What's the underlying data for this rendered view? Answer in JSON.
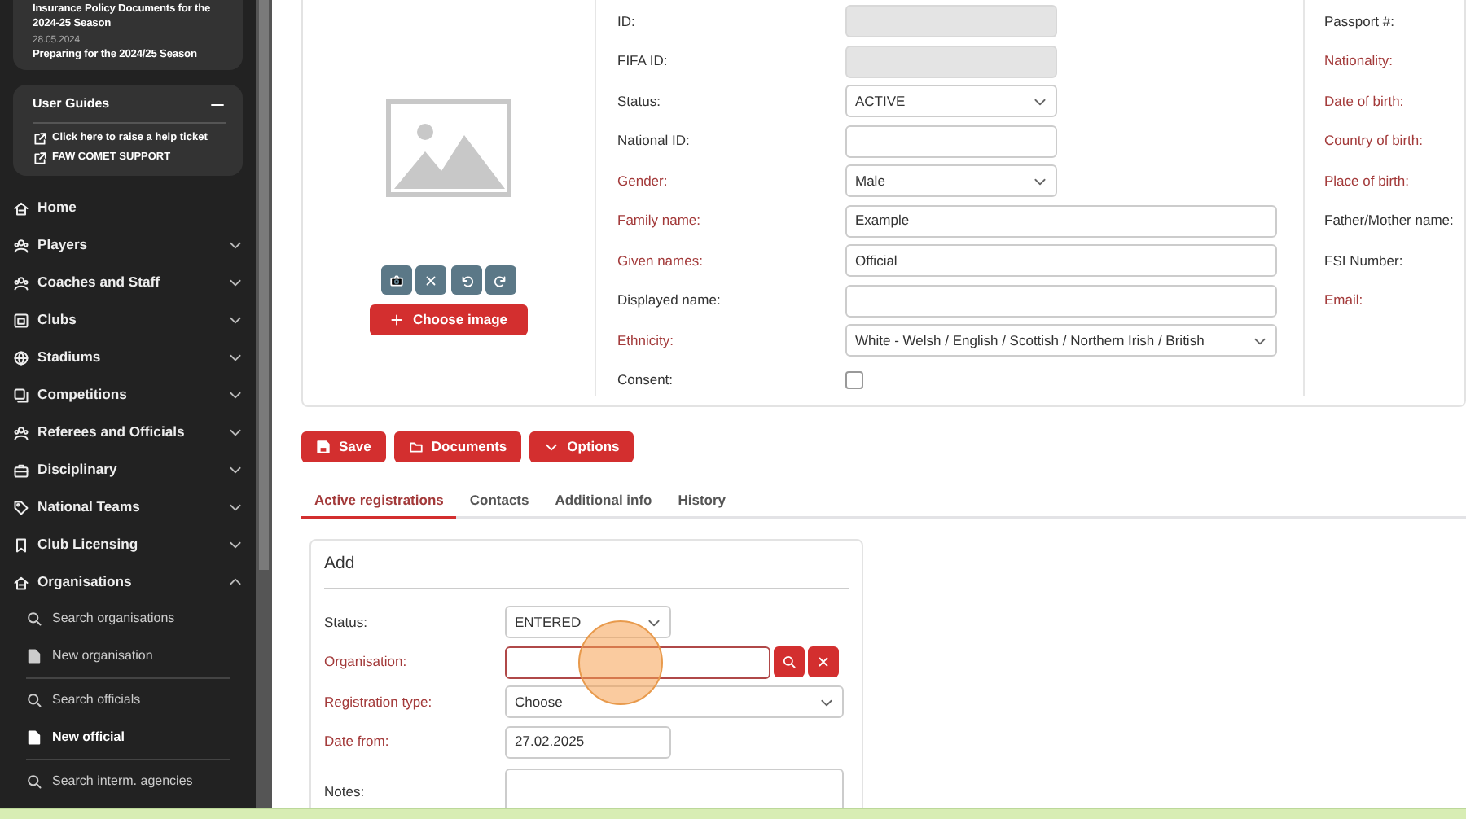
{
  "sidebar": {
    "news": {
      "title": "Insurance Policy Documents for the 2024-25 Season",
      "date": "28.05.2024",
      "next_title": "Preparing for the 2024/25 Season"
    },
    "user_guides": {
      "title": "User Guides",
      "expanded": true,
      "links": [
        "Click here to raise a help ticket",
        "FAW COMET SUPPORT"
      ]
    },
    "menu": [
      {
        "label": "Home",
        "kind": "link"
      },
      {
        "label": "Players",
        "kind": "group",
        "expanded": false
      },
      {
        "label": "Coaches and Staff",
        "kind": "group",
        "expanded": false
      },
      {
        "label": "Clubs",
        "kind": "group",
        "expanded": false
      },
      {
        "label": "Stadiums",
        "kind": "group",
        "expanded": false
      },
      {
        "label": "Competitions",
        "kind": "group",
        "expanded": false
      },
      {
        "label": "Referees and Officials",
        "kind": "group",
        "expanded": false
      },
      {
        "label": "Disciplinary",
        "kind": "group",
        "expanded": false
      },
      {
        "label": "National Teams",
        "kind": "group",
        "expanded": false
      },
      {
        "label": "Club Licensing",
        "kind": "group",
        "expanded": false
      },
      {
        "label": "Organisations",
        "kind": "group",
        "expanded": true,
        "sections": [
          {
            "items": [
              {
                "label": "Search organisations",
                "kind": "search",
                "selected": false
              },
              {
                "label": "New organisation",
                "kind": "new",
                "selected": false
              }
            ]
          },
          {
            "items": [
              {
                "label": "Search officials",
                "kind": "search",
                "selected": false
              },
              {
                "label": "New official",
                "kind": "new",
                "selected": true
              }
            ]
          },
          {
            "items": [
              {
                "label": "Search interm. agencies",
                "kind": "search",
                "selected": false
              }
            ]
          }
        ]
      }
    ]
  },
  "photo": {
    "choose_button": "Choose image"
  },
  "fields": [
    {
      "label": "ID:",
      "kind": "text",
      "required": false,
      "disabled": true
    },
    {
      "label": "FIFA ID:",
      "kind": "text",
      "required": false,
      "disabled": true
    },
    {
      "label": "Status:",
      "kind": "select",
      "required": false,
      "value": "ACTIVE"
    },
    {
      "label": "National ID:",
      "kind": "text",
      "required": false,
      "disabled": false
    },
    {
      "label": "Gender:",
      "kind": "select",
      "required": true,
      "value": "Male"
    },
    {
      "label": "Family name:",
      "kind": "text",
      "required": true,
      "disabled": false,
      "value": "Example"
    },
    {
      "label": "Given names:",
      "kind": "text",
      "required": true,
      "disabled": false,
      "value": "Official"
    },
    {
      "label": "Displayed name:",
      "kind": "text",
      "required": false,
      "disabled": false
    },
    {
      "label": "Ethnicity:",
      "kind": "select",
      "required": true,
      "value": "White - Welsh / English / Scottish / Northern Irish / British"
    },
    {
      "label": "Consent:",
      "kind": "checkbox",
      "required": false,
      "checked": false
    }
  ],
  "right_fields": [
    {
      "label": "Passport #:",
      "required": false
    },
    {
      "label": "Nationality:",
      "required": true
    },
    {
      "label": "Date of birth:",
      "required": true
    },
    {
      "label": "Country of birth:",
      "required": true
    },
    {
      "label": "Place of birth:",
      "required": true
    },
    {
      "label": "Father/Mother name:",
      "required": false
    },
    {
      "label": "FSI Number:",
      "required": false
    },
    {
      "label": "Email:",
      "required": true
    }
  ],
  "actions": [
    {
      "label": "Save",
      "kind": "save"
    },
    {
      "label": "Documents",
      "kind": "folder"
    },
    {
      "label": "Options",
      "kind": "dropdown"
    }
  ],
  "tabs": [
    {
      "label": "Active registrations",
      "selected": true
    },
    {
      "label": "Contacts",
      "selected": false
    },
    {
      "label": "Additional info",
      "selected": false
    },
    {
      "label": "History",
      "selected": false
    }
  ],
  "add_card": {
    "title": "Add",
    "fields": [
      {
        "label": "Status:",
        "kind": "select",
        "required": false,
        "value": "ENTERED"
      },
      {
        "label": "Organisation:",
        "kind": "lookup",
        "required": true
      },
      {
        "label": "Registration type:",
        "kind": "select",
        "required": true,
        "value": "Choose"
      },
      {
        "label": "Date from:",
        "kind": "text",
        "required": true,
        "value": "27.02.2025"
      },
      {
        "label": "Notes:",
        "kind": "textarea",
        "required": false
      }
    ]
  }
}
